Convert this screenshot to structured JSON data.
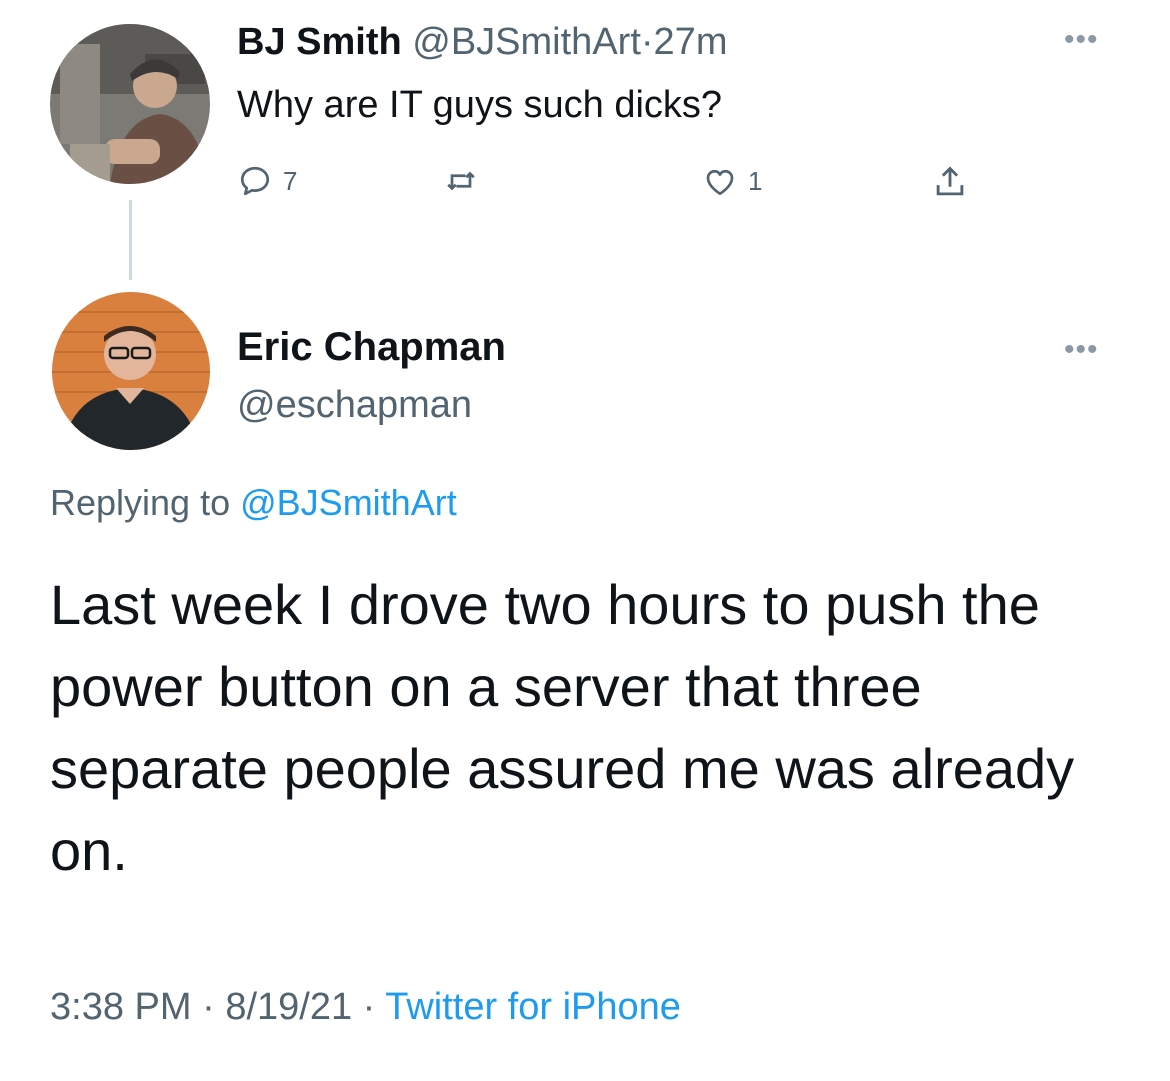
{
  "parent_tweet": {
    "display_name": "BJ Smith",
    "handle": "@BJSmithArt",
    "separator": "·",
    "time": "27m",
    "text": "Why are IT guys such dicks?",
    "reply_count": "7",
    "like_count": "1",
    "icons": [
      "more-icon",
      "reply-icon",
      "retweet-icon",
      "like-icon",
      "share-icon"
    ]
  },
  "reply_tweet": {
    "display_name": "Eric Chapman",
    "handle": "@eschapman",
    "replying_prefix": "Replying to",
    "replying_to": "@BJSmithArt",
    "text": "Last week I drove two hours to push the power button on a server that three separate people assured me was already on.",
    "time": "3:38 PM",
    "date": "8/19/21",
    "separator": "·",
    "source": "Twitter for iPhone"
  },
  "colors": {
    "text_primary": "#0f1419",
    "text_secondary": "#536471",
    "link": "#1d9bf0",
    "thread_line": "#cfd9de"
  }
}
